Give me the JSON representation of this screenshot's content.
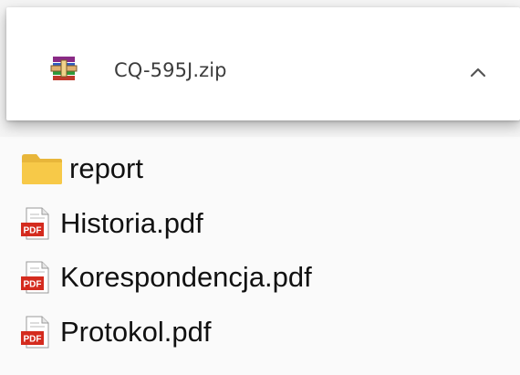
{
  "download": {
    "filename": "CQ-595J.zip",
    "icon": "winrar-archive-icon"
  },
  "files": [
    {
      "name": "report",
      "type": "folder",
      "icon": "folder-icon"
    },
    {
      "name": "Historia.pdf",
      "type": "pdf",
      "icon": "pdf-icon"
    },
    {
      "name": "Korespondencja.pdf",
      "type": "pdf",
      "icon": "pdf-icon"
    },
    {
      "name": "Protokol.pdf",
      "type": "pdf",
      "icon": "pdf-icon"
    }
  ],
  "colors": {
    "folder": "#f7c948",
    "pdf_badge": "#d42b1e",
    "chevron": "#555555"
  }
}
